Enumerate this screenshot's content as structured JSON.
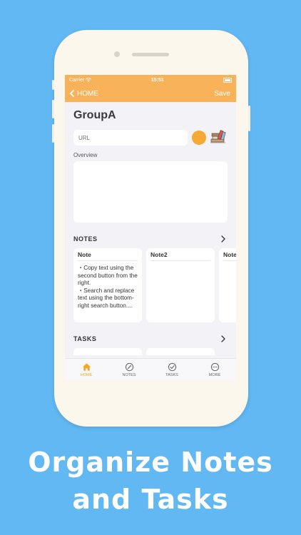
{
  "status_bar": {
    "carrier": "Carrier",
    "time": "15:51"
  },
  "nav": {
    "back_label": "HOME",
    "save_label": "Save"
  },
  "group": {
    "title": "GroupA"
  },
  "url_field": {
    "placeholder": "URL"
  },
  "overview": {
    "label": "Overview"
  },
  "colors": {
    "accent": "#f8b259",
    "color_dot": "#f7a935",
    "background": "#62b8f2"
  },
  "notes_section": {
    "title": "NOTES",
    "cards": [
      {
        "title": "Note",
        "body": "・Copy text using the second button from the right.\n・Search and replace text using the bottom-right search button...."
      },
      {
        "title": "Note2",
        "body": ""
      },
      {
        "title": "Note",
        "body": ""
      }
    ]
  },
  "tasks_section": {
    "title": "TASKS"
  },
  "tabbar": {
    "items": [
      {
        "label": "HOME",
        "icon": "home-icon",
        "active": true
      },
      {
        "label": "NOTES",
        "icon": "notes-icon",
        "active": false
      },
      {
        "label": "TASKS",
        "icon": "tasks-icon",
        "active": false
      },
      {
        "label": "MORE",
        "icon": "more-icon",
        "active": false
      }
    ]
  },
  "caption": {
    "line1": "Organize Notes",
    "line2": "and Tasks"
  }
}
